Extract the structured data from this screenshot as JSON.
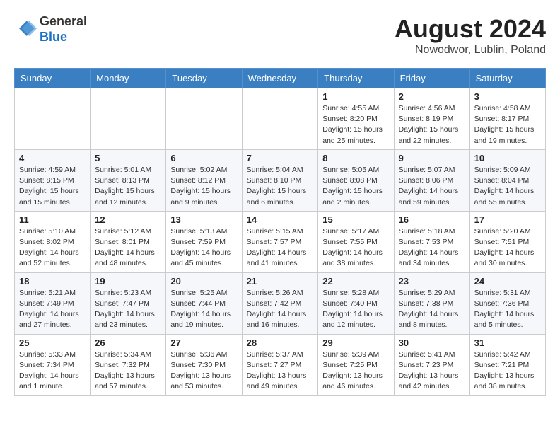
{
  "header": {
    "logo_general": "General",
    "logo_blue": "Blue",
    "month_year": "August 2024",
    "location": "Nowodwor, Lublin, Poland"
  },
  "weekdays": [
    "Sunday",
    "Monday",
    "Tuesday",
    "Wednesday",
    "Thursday",
    "Friday",
    "Saturday"
  ],
  "weeks": [
    [
      {
        "day": "",
        "info": ""
      },
      {
        "day": "",
        "info": ""
      },
      {
        "day": "",
        "info": ""
      },
      {
        "day": "",
        "info": ""
      },
      {
        "day": "1",
        "info": "Sunrise: 4:55 AM\nSunset: 8:20 PM\nDaylight: 15 hours\nand 25 minutes."
      },
      {
        "day": "2",
        "info": "Sunrise: 4:56 AM\nSunset: 8:19 PM\nDaylight: 15 hours\nand 22 minutes."
      },
      {
        "day": "3",
        "info": "Sunrise: 4:58 AM\nSunset: 8:17 PM\nDaylight: 15 hours\nand 19 minutes."
      }
    ],
    [
      {
        "day": "4",
        "info": "Sunrise: 4:59 AM\nSunset: 8:15 PM\nDaylight: 15 hours\nand 15 minutes."
      },
      {
        "day": "5",
        "info": "Sunrise: 5:01 AM\nSunset: 8:13 PM\nDaylight: 15 hours\nand 12 minutes."
      },
      {
        "day": "6",
        "info": "Sunrise: 5:02 AM\nSunset: 8:12 PM\nDaylight: 15 hours\nand 9 minutes."
      },
      {
        "day": "7",
        "info": "Sunrise: 5:04 AM\nSunset: 8:10 PM\nDaylight: 15 hours\nand 6 minutes."
      },
      {
        "day": "8",
        "info": "Sunrise: 5:05 AM\nSunset: 8:08 PM\nDaylight: 15 hours\nand 2 minutes."
      },
      {
        "day": "9",
        "info": "Sunrise: 5:07 AM\nSunset: 8:06 PM\nDaylight: 14 hours\nand 59 minutes."
      },
      {
        "day": "10",
        "info": "Sunrise: 5:09 AM\nSunset: 8:04 PM\nDaylight: 14 hours\nand 55 minutes."
      }
    ],
    [
      {
        "day": "11",
        "info": "Sunrise: 5:10 AM\nSunset: 8:02 PM\nDaylight: 14 hours\nand 52 minutes."
      },
      {
        "day": "12",
        "info": "Sunrise: 5:12 AM\nSunset: 8:01 PM\nDaylight: 14 hours\nand 48 minutes."
      },
      {
        "day": "13",
        "info": "Sunrise: 5:13 AM\nSunset: 7:59 PM\nDaylight: 14 hours\nand 45 minutes."
      },
      {
        "day": "14",
        "info": "Sunrise: 5:15 AM\nSunset: 7:57 PM\nDaylight: 14 hours\nand 41 minutes."
      },
      {
        "day": "15",
        "info": "Sunrise: 5:17 AM\nSunset: 7:55 PM\nDaylight: 14 hours\nand 38 minutes."
      },
      {
        "day": "16",
        "info": "Sunrise: 5:18 AM\nSunset: 7:53 PM\nDaylight: 14 hours\nand 34 minutes."
      },
      {
        "day": "17",
        "info": "Sunrise: 5:20 AM\nSunset: 7:51 PM\nDaylight: 14 hours\nand 30 minutes."
      }
    ],
    [
      {
        "day": "18",
        "info": "Sunrise: 5:21 AM\nSunset: 7:49 PM\nDaylight: 14 hours\nand 27 minutes."
      },
      {
        "day": "19",
        "info": "Sunrise: 5:23 AM\nSunset: 7:47 PM\nDaylight: 14 hours\nand 23 minutes."
      },
      {
        "day": "20",
        "info": "Sunrise: 5:25 AM\nSunset: 7:44 PM\nDaylight: 14 hours\nand 19 minutes."
      },
      {
        "day": "21",
        "info": "Sunrise: 5:26 AM\nSunset: 7:42 PM\nDaylight: 14 hours\nand 16 minutes."
      },
      {
        "day": "22",
        "info": "Sunrise: 5:28 AM\nSunset: 7:40 PM\nDaylight: 14 hours\nand 12 minutes."
      },
      {
        "day": "23",
        "info": "Sunrise: 5:29 AM\nSunset: 7:38 PM\nDaylight: 14 hours\nand 8 minutes."
      },
      {
        "day": "24",
        "info": "Sunrise: 5:31 AM\nSunset: 7:36 PM\nDaylight: 14 hours\nand 5 minutes."
      }
    ],
    [
      {
        "day": "25",
        "info": "Sunrise: 5:33 AM\nSunset: 7:34 PM\nDaylight: 14 hours\nand 1 minute."
      },
      {
        "day": "26",
        "info": "Sunrise: 5:34 AM\nSunset: 7:32 PM\nDaylight: 13 hours\nand 57 minutes."
      },
      {
        "day": "27",
        "info": "Sunrise: 5:36 AM\nSunset: 7:30 PM\nDaylight: 13 hours\nand 53 minutes."
      },
      {
        "day": "28",
        "info": "Sunrise: 5:37 AM\nSunset: 7:27 PM\nDaylight: 13 hours\nand 49 minutes."
      },
      {
        "day": "29",
        "info": "Sunrise: 5:39 AM\nSunset: 7:25 PM\nDaylight: 13 hours\nand 46 minutes."
      },
      {
        "day": "30",
        "info": "Sunrise: 5:41 AM\nSunset: 7:23 PM\nDaylight: 13 hours\nand 42 minutes."
      },
      {
        "day": "31",
        "info": "Sunrise: 5:42 AM\nSunset: 7:21 PM\nDaylight: 13 hours\nand 38 minutes."
      }
    ]
  ]
}
